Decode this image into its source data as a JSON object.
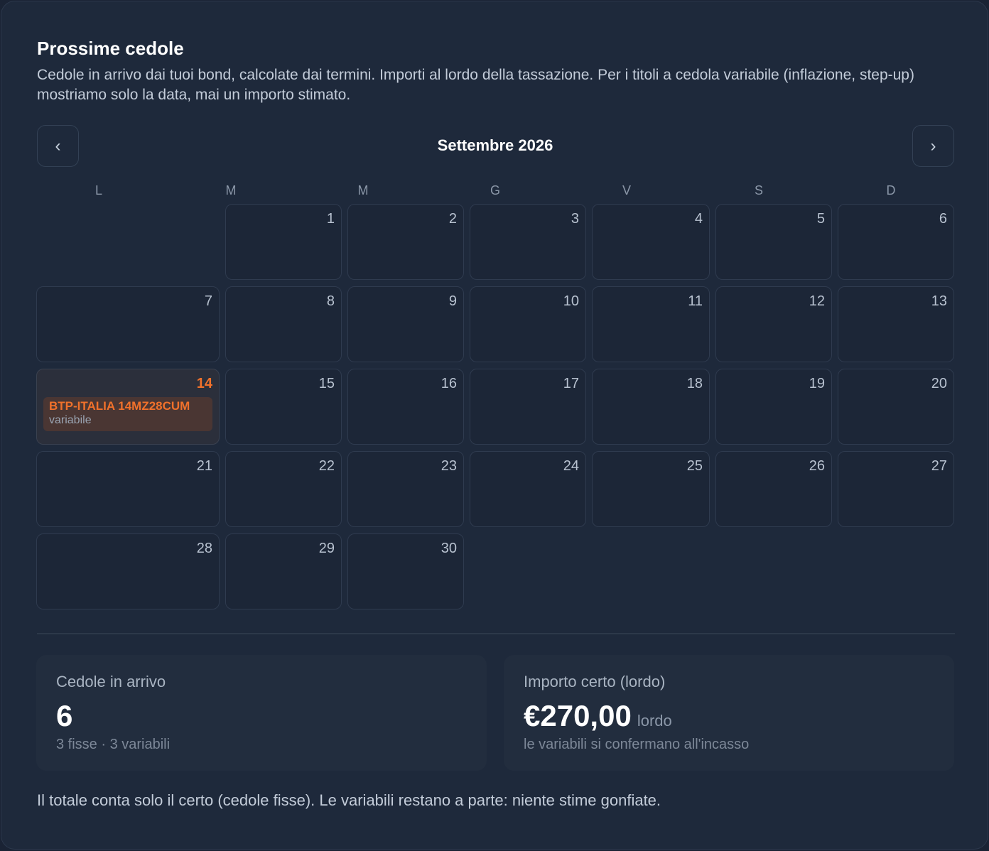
{
  "header": {
    "title": "Prossime cedole",
    "description": "Cedole in arrivo dai tuoi bond, calcolate dai termini. Importi al lordo della tassazione. Per i titoli a cedola variabile (inflazione, step-up) mostriamo solo la data, mai un importo stimato."
  },
  "calendar": {
    "month_label": "Settembre 2026",
    "prev_label": "‹",
    "next_label": "›",
    "weekdays": [
      "L",
      "M",
      "M",
      "G",
      "V",
      "S",
      "D"
    ],
    "days": [
      "1",
      "2",
      "3",
      "4",
      "5",
      "6",
      "7",
      "8",
      "9",
      "10",
      "11",
      "12",
      "13",
      "14",
      "15",
      "16",
      "17",
      "18",
      "19",
      "20",
      "21",
      "22",
      "23",
      "24",
      "25",
      "26",
      "27",
      "28",
      "29",
      "30"
    ],
    "today": "14",
    "event": {
      "day": "14",
      "name": "BTP-ITALIA 14MZ28CUM",
      "type": "variabile"
    }
  },
  "stats": {
    "incoming": {
      "label": "Cedole in arrivo",
      "value": "6",
      "sub": "3 fisse · 3 variabili"
    },
    "certain": {
      "label": "Importo certo (lordo)",
      "value": "€270,00",
      "unit": "lordo",
      "sub": "le variabili si confermano all'incasso"
    }
  },
  "footer_note": "Il totale conta solo il certo (cedole fisse). Le variabili restano a parte: niente stime gonfiate.",
  "colors": {
    "accent": "#f0712b",
    "background": "#1e293b",
    "event_bg": "#4a3633"
  }
}
